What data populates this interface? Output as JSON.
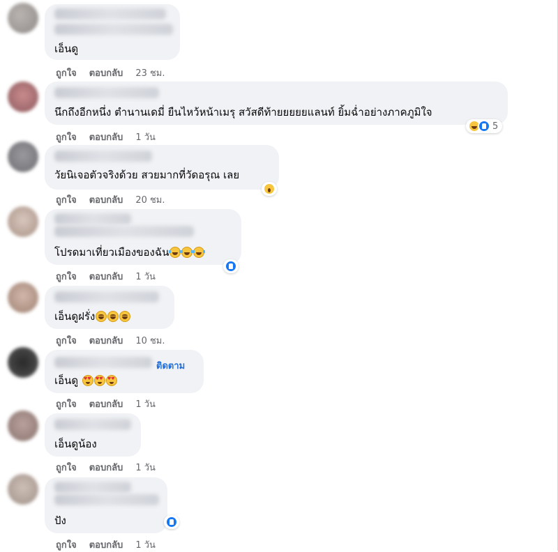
{
  "actions": {
    "like": "ถูกใจ",
    "reply": "ตอบกลับ"
  },
  "colors": {
    "bubble": "#f0f2f5",
    "meta_text": "#65676b",
    "follow": "#216fdb",
    "like_blue": "#1877f2"
  },
  "comments": [
    {
      "text": "เอ็นดู",
      "time": "23 ชม."
    },
    {
      "text": "นึกถึงอีกหนึ่ง ตำนานเดมี่ ยืนไหว้หน้าเมรุ สวัสดีท้ายยยยยแลนท์ ยิ้มฉ่ำอย่างภาคภูมิใจ",
      "time": "1 วัน",
      "reactions": {
        "icons": [
          "haha-icon",
          "like-icon"
        ],
        "count": "5"
      }
    },
    {
      "text": "วัยนิเจอตัวจริงด้วย สวยมากที่วัดอรุณ เลย",
      "time": "20 ชม.",
      "reactions": {
        "icons": [
          "wow-icon"
        ]
      }
    },
    {
      "text": "โปรดมาเที่ยวเมืองของฉัน",
      "time": "1 วัน",
      "emojis": [
        "tears-of-joy-emoji",
        "tears-of-joy-emoji",
        "tears-of-joy-emoji"
      ],
      "reactions": {
        "icons": [
          "like-icon"
        ]
      }
    },
    {
      "text": "เอ็นดูฝรั่ง",
      "time": "10 ชม.",
      "emojis": [
        "grinning-emoji",
        "grinning-emoji",
        "grinning-emoji"
      ]
    },
    {
      "text": "เอ็นดู",
      "time": "1 วัน",
      "follow": "ติดตาม",
      "emojis": [
        "heart-eyes-emoji",
        "heart-eyes-emoji",
        "heart-eyes-emoji"
      ]
    },
    {
      "text": "เอ็นดูน้อง",
      "time": "1 วัน"
    },
    {
      "text": "ปัง",
      "time": "1 วัน",
      "reactions": {
        "icons": [
          "like-icon"
        ]
      }
    }
  ]
}
